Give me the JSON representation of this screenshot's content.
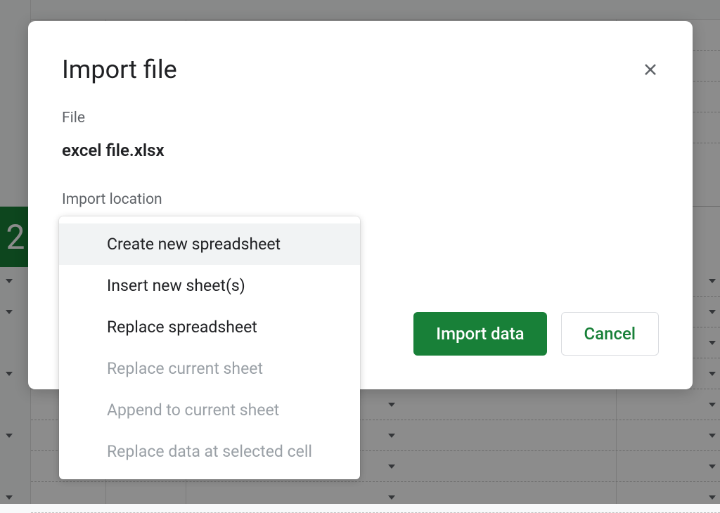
{
  "modal": {
    "title": "Import file",
    "file_label": "File",
    "file_name": "excel file.xlsx",
    "import_location_label": "Import location",
    "import_button": "Import data",
    "cancel_button": "Cancel"
  },
  "dropdown": {
    "options": [
      {
        "label": "Create new spreadsheet",
        "enabled": true,
        "highlighted": true
      },
      {
        "label": "Insert new sheet(s)",
        "enabled": true,
        "highlighted": false
      },
      {
        "label": "Replace spreadsheet",
        "enabled": true,
        "highlighted": false
      },
      {
        "label": "Replace current sheet",
        "enabled": false,
        "highlighted": false
      },
      {
        "label": "Append to current sheet",
        "enabled": false,
        "highlighted": false
      },
      {
        "label": "Replace data at selected cell",
        "enabled": false,
        "highlighted": false
      }
    ]
  },
  "background": {
    "selected_row_number": "2"
  }
}
